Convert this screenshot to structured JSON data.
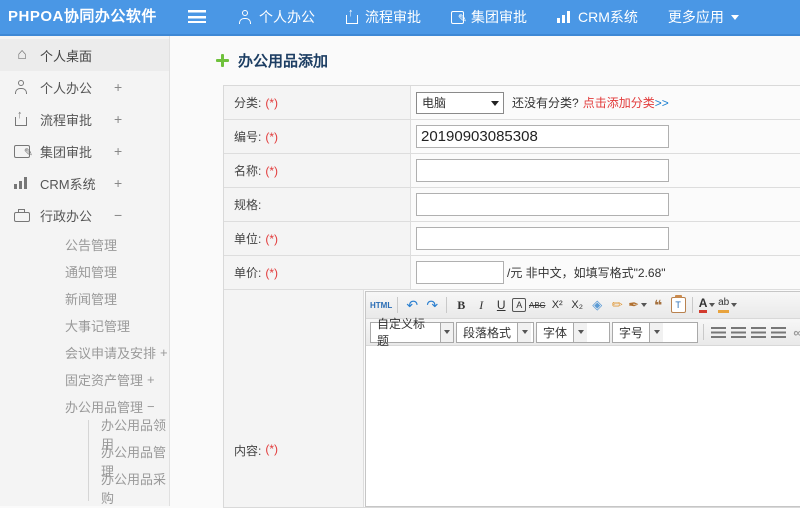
{
  "colors": {
    "topbar": "#4a97e5",
    "link_blue": "#1b7fd0",
    "required_red": "#e23b3b",
    "title_navy": "#1d3e63",
    "plus_green": "#6fc13c"
  },
  "topbar": {
    "logo": "PHPOA协同办公软件",
    "items": [
      {
        "label": "个人办公",
        "icon": "person-icon"
      },
      {
        "label": "流程审批",
        "icon": "approval-icon"
      },
      {
        "label": "集团审批",
        "icon": "edit-icon"
      },
      {
        "label": "CRM系统",
        "icon": "chart-icon"
      },
      {
        "label": "更多应用",
        "icon": "caret-down-icon"
      }
    ]
  },
  "sidebar": {
    "items": [
      {
        "label": "个人桌面",
        "icon": "home-icon",
        "expand": ""
      },
      {
        "label": "个人办公",
        "icon": "person-icon",
        "expand": "+"
      },
      {
        "label": "流程审批",
        "icon": "approval-icon",
        "expand": "+"
      },
      {
        "label": "集团审批",
        "icon": "edit-icon",
        "expand": "+"
      },
      {
        "label": "CRM系统",
        "icon": "chart-icon",
        "expand": "+"
      },
      {
        "label": "行政办公",
        "icon": "briefcase-icon",
        "expand": "−"
      }
    ],
    "subitems": [
      {
        "label": "公告管理",
        "expand": ""
      },
      {
        "label": "通知管理",
        "expand": ""
      },
      {
        "label": "新闻管理",
        "expand": ""
      },
      {
        "label": "大事记管理",
        "expand": ""
      },
      {
        "label": "会议申请及安排",
        "expand": "+"
      },
      {
        "label": "固定资产管理",
        "expand": "+"
      },
      {
        "label": "办公用品管理",
        "expand": "−"
      }
    ],
    "subsubitems": [
      {
        "label": "办公用品领用"
      },
      {
        "label": "办公用品管理"
      },
      {
        "label": "办公用品采购"
      }
    ]
  },
  "main": {
    "page_title": "办公用品添加",
    "form": {
      "category": {
        "label": "分类:",
        "required": "(*)",
        "selected": "电脑",
        "hint": "还没有分类?",
        "hint_link": "点击添加分类",
        "hint_arrow": ">>"
      },
      "code": {
        "label": "编号:",
        "required": "(*)",
        "value": "20190903085308"
      },
      "name": {
        "label": "名称:",
        "required": "(*)",
        "value": ""
      },
      "spec": {
        "label": "规格:",
        "required": "",
        "value": ""
      },
      "unit": {
        "label": "单位:",
        "required": "(*)",
        "value": ""
      },
      "price": {
        "label": "单价:",
        "required": "(*)",
        "value": "",
        "suffix": "/元 非中文，如填写格式\"2.68\""
      },
      "content": {
        "label": "内容:",
        "required": "(*)"
      }
    }
  },
  "editor": {
    "html_btn": "HTML",
    "undo": "↶",
    "redo": "↷",
    "bold": "B",
    "italic": "I",
    "underline": "U",
    "autotypeset": "A",
    "strikethrough": "ABC",
    "superscript": "X²",
    "subscript": "X₂",
    "eraser": "◈",
    "cleandoc": "✏",
    "formatmatch": "✒",
    "blockquote": "❝",
    "pastetext": "T",
    "fontcolor": "A",
    "highlight": "ab",
    "link": "∞",
    "dropdowns": [
      {
        "label": "自定义标题"
      },
      {
        "label": "段落格式"
      },
      {
        "label": "字体"
      },
      {
        "label": "字号"
      }
    ]
  }
}
